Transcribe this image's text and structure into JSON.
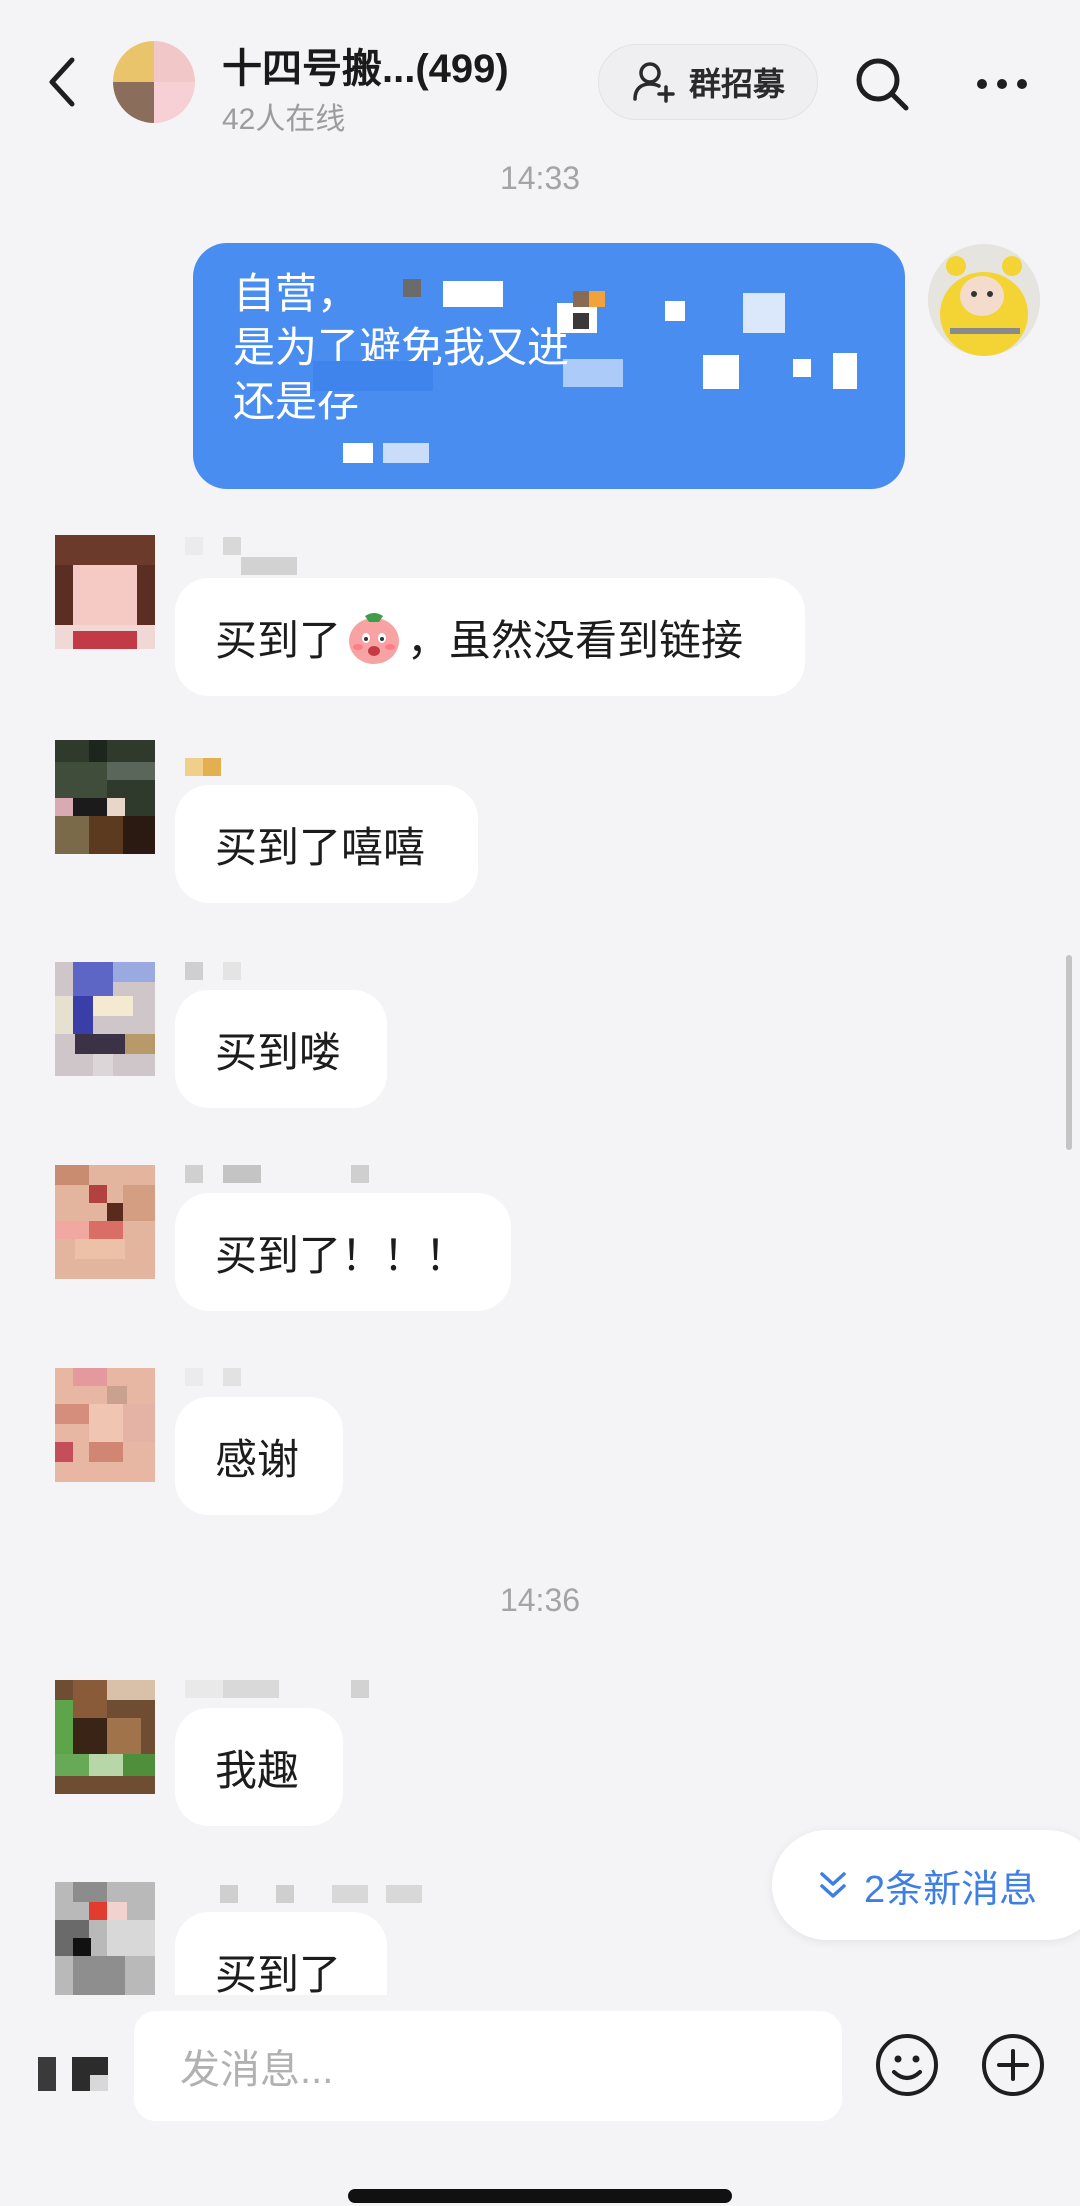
{
  "header": {
    "title": "十四号搬...(499)",
    "online": "42人在线",
    "recruit_label": "群招募",
    "icons": [
      "chevron-left-icon",
      "add-user-icon",
      "search-icon",
      "more-icon"
    ]
  },
  "timestamps": [
    "14:33",
    "14:36"
  ],
  "my_message": {
    "lines": [
      "自营，",
      "是为了避免我又进",
      "还是存"
    ]
  },
  "messages": [
    {
      "text_before": "买到了",
      "emoji": "blushing-sticker",
      "text_after": "，虽然没看到链接"
    },
    {
      "text": "买到了嘻嘻"
    },
    {
      "text": "买到喽"
    },
    {
      "text": "买到了！！！"
    },
    {
      "text": "感谢"
    },
    {
      "text": "我趣"
    },
    {
      "text": "买到了"
    }
  ],
  "new_messages": {
    "label": "2条新消息",
    "icon": "double-chevron-down-icon"
  },
  "input": {
    "placeholder": "发消息..."
  },
  "bottom_icons": [
    "voice-icon",
    "emoji-icon",
    "plus-icon"
  ],
  "colors": {
    "accent": "#4a8df0",
    "link": "#3d7fe6",
    "background": "#f4f4f6",
    "bubble": "#ffffff"
  }
}
